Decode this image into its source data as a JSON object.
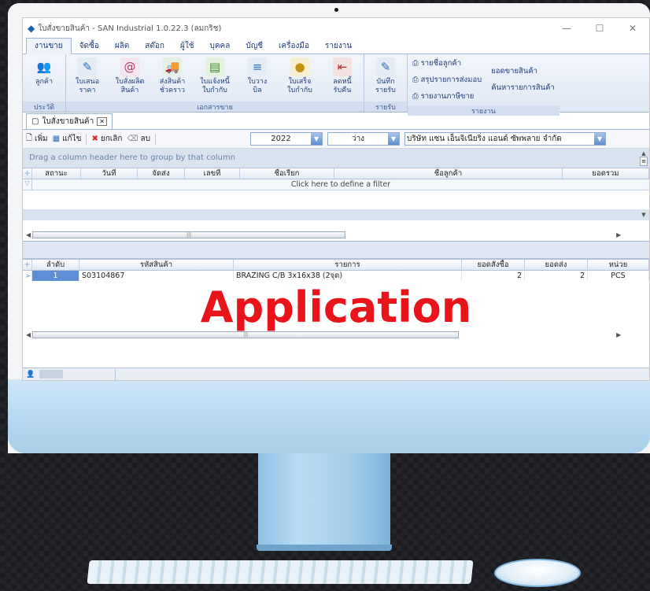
{
  "window": {
    "title": "ใบสั่งขายสินค้า - SAN Industrial  1.0.22.3 (ลมกริช)",
    "controls": [
      "—",
      "☐",
      "✕"
    ]
  },
  "menu": {
    "tabs": [
      "งานขาย",
      "จัดซื้อ",
      "ผลิต",
      "สต๊อก",
      "ผู้ใช้",
      "บุคคล",
      "บัญชี",
      "เครื่องมือ",
      "รายงาน"
    ]
  },
  "ribbon": {
    "history": {
      "button": "ลูกค้า",
      "label": "ประวัติ"
    },
    "documents": {
      "label": "เอกสารขาย",
      "buttons": [
        {
          "line1": "ใบเสนอ",
          "line2": "ราคา"
        },
        {
          "line1": "ใบสั่งผลิต",
          "line2": "สินค้า"
        },
        {
          "line1": "ส่งสินค้า",
          "line2": "ชั่วคราว"
        },
        {
          "line1": "ใบแจ้งหนี้",
          "line2": "ใบกำกับ"
        },
        {
          "line1": "ใบวาง",
          "line2": "บิล"
        },
        {
          "line1": "ใบเสร็จ",
          "line2": "ใบกำกับ"
        },
        {
          "line1": "ลดหนี้",
          "line2": "รับคืน"
        }
      ]
    },
    "receipts": {
      "button_line1": "บันทึก",
      "button_line2": "รายรับ",
      "label": "รายรับ"
    },
    "reports": {
      "label": "รายงาน",
      "left": [
        "รายชื่อลูกค้า",
        "สรุปรายการส่งมอบ",
        "รายงานภาษีขาย"
      ],
      "right": [
        "ยอดขายสินค้า",
        "ค้นหารายการสินค้า"
      ]
    }
  },
  "doc_tab": {
    "label": "ใบสั่งขายสินค้า",
    "close": "✕"
  },
  "toolbar": {
    "add": "เพิ่ม",
    "edit": "แก้ไข",
    "cancel": "ยกเลิก",
    "delete": "ลบ",
    "year": "2022",
    "status": "ว่าง",
    "company": "บริษัท แซน เอ็นจิเนียริ่ง แอนด์ ซัพพลาย จำกัด"
  },
  "orders_grid": {
    "group_hint": "Drag a column header here to group by that column",
    "columns": [
      "สถานะ",
      "วันที่",
      "จัดส่ง",
      "เลขที่",
      "ชื่อเรียก",
      "ชื่อลูกค้า",
      "ยอดรวม"
    ],
    "filter_hint": "Click here to define a filter"
  },
  "items_grid": {
    "columns": [
      "ลำดับ",
      "รหัสสินค้า",
      "รายการ",
      "ยอดสั่งซื้อ",
      "ยอดส่ง",
      "หน่วย"
    ],
    "rows": [
      {
        "seq": "1",
        "code": "S03104867",
        "description": "BRAZING C/B 3x16x38 (2จุด)",
        "ordered": "2",
        "delivered": "2",
        "unit": "PCS"
      }
    ]
  },
  "overlay_text": "Application",
  "colors": {
    "accent": "#1e3c78",
    "watermark": "#e8141a",
    "chin": "#b7d8f0"
  }
}
